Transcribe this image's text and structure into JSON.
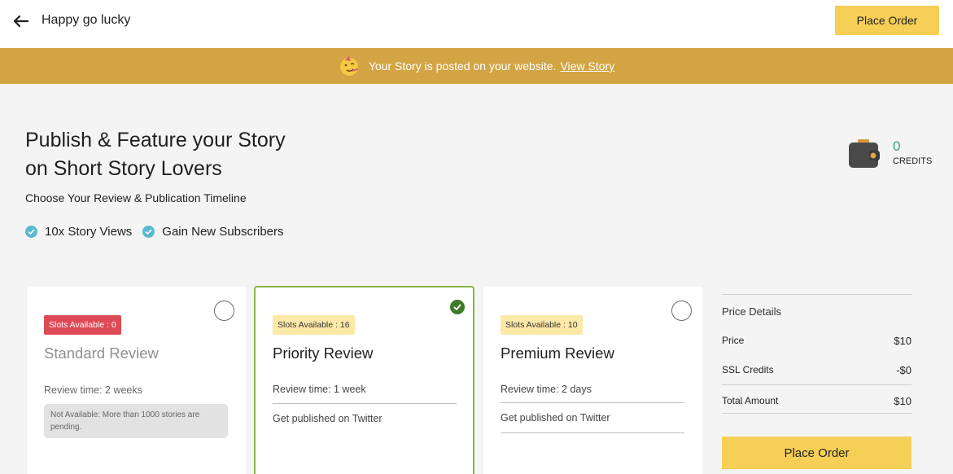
{
  "header": {
    "title": "Happy go lucky",
    "place_order_label": "Place Order"
  },
  "banner": {
    "message": "Your Story is posted on your website.",
    "link_label": "View Story",
    "bg_color": "#d2a443"
  },
  "intro": {
    "heading_line1": "Publish & Feature your Story",
    "heading_line2": "on Short Story Lovers",
    "subheading": "Choose Your Review & Publication Timeline",
    "features": [
      "10x Story Views",
      "Gain New Subscribers"
    ]
  },
  "credits": {
    "value": "0",
    "label": "CREDITS"
  },
  "plans": [
    {
      "slots": "Slots Available : 0",
      "name": "Standard Review",
      "review_time": "Review time: 2 weeks",
      "note": "Not Available: More than 1000 stories are pending.",
      "selected": false
    },
    {
      "slots": "Slots Available : 16",
      "name": "Priority Review",
      "review_time": "Review time: 1 week",
      "perk": "Get published on Twitter",
      "selected": true
    },
    {
      "slots": "Slots Available : 10",
      "name": "Premium Review",
      "review_time": "Review time: 2 days",
      "perk": "Get published on Twitter",
      "selected": false
    }
  ],
  "price_details": {
    "title": "Price Details",
    "price_label": "Price",
    "price_value": "$10",
    "ssl_label": "SSL Credits",
    "ssl_value": "-$0",
    "total_label": "Total Amount",
    "total_value": "$10",
    "place_order_label": "Place Order"
  },
  "colors": {
    "accent_yellow": "#f6cf56",
    "selected_border": "#8ab34a",
    "unavailable_badge": "#dd4a55",
    "credits_green": "#3aa387"
  }
}
